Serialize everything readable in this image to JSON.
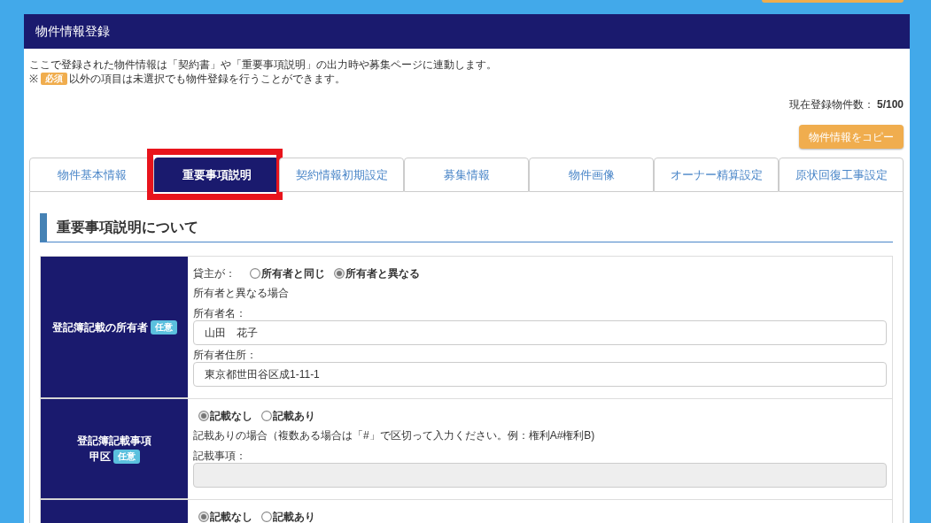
{
  "page": {
    "title": "物件情報登録"
  },
  "notice": {
    "line_1": "ここで登録された物件情報は「契約書」や「重要事項説明」の出力時や募集ページに連動します。",
    "line_2": {
      "prefix": "※",
      "badge": "必須",
      "text": "以外の項目は未選択でも物件登録を行うことができます。"
    }
  },
  "count": "現在登録物件数： **5/100**",
  "copy_button": "物件情報をコピー",
  "tabs": [
    {
      "label": "物件基本情報",
      "selected": false,
      "highlighted": false
    },
    {
      "label": "重要事項説明",
      "selected": true,
      "highlighted": true
    },
    {
      "label": "契約情報初期設定",
      "selected": false,
      "highlighted": false
    },
    {
      "label": "募集情報",
      "selected": false,
      "highlighted": false
    },
    {
      "label": "物件画像",
      "selected": false,
      "highlighted": false
    },
    {
      "label": "オーナー精算設定",
      "selected": false,
      "highlighted": false
    },
    {
      "label": "原状回復工事設定",
      "selected": false,
      "highlighted": false
    }
  ],
  "section": {
    "title": "重要事項説明について"
  },
  "rows": [
    {
      "header": [
        "登記簿記載の所有者"
      ],
      "badge": "任意",
      "items": [
        {
          "kind": "radio_group",
          "label": "貸主が：",
          "options": [
            {
              "label": "所有者と同じ",
              "selected": false
            },
            {
              "label": "所有者と異なる",
              "selected": true
            }
          ]
        },
        {
          "kind": "note",
          "text": "所有者と異なる場合"
        },
        {
          "kind": "field",
          "label": "所有者名：",
          "value": "山田　花子",
          "disabled": false
        },
        {
          "kind": "field",
          "label": "所有者住所：",
          "value": "東京都世田谷区成1-11-1",
          "disabled": false
        }
      ]
    },
    {
      "header": [
        "登記簿記載事項",
        "甲区"
      ],
      "badge": "任意",
      "items": [
        {
          "kind": "radio_group",
          "options": [
            {
              "label": "記載なし",
              "selected": true
            },
            {
              "label": "記載あり",
              "selected": false
            }
          ]
        },
        {
          "kind": "note",
          "text": "記載ありの場合（複数ある場合は「#」で区切って入力ください。例：権利A#権利B)"
        },
        {
          "kind": "field",
          "label": "記載事項：",
          "disabled": true
        }
      ]
    },
    {
      "items": [
        {
          "kind": "radio_group",
          "options": [
            {
              "label": "記載なし",
              "selected": true
            },
            {
              "label": "記載あり",
              "selected": false
            }
          ]
        }
      ]
    }
  ]
}
